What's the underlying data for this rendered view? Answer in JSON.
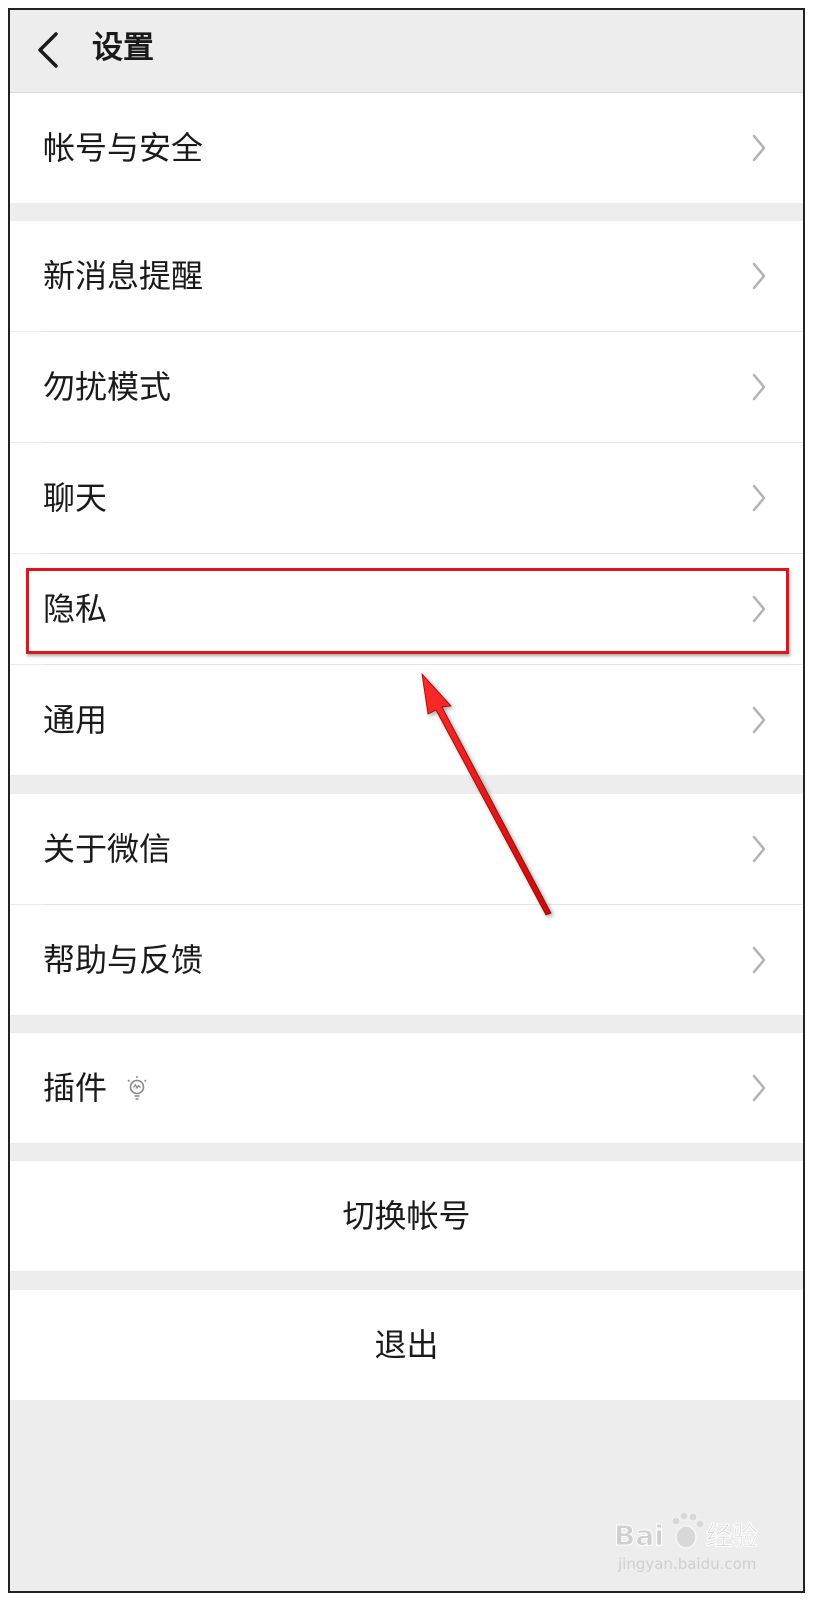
{
  "header": {
    "title": "设置"
  },
  "menu": {
    "account_security": "帐号与安全",
    "new_message": "新消息提醒",
    "do_not_disturb": "勿扰模式",
    "chat": "聊天",
    "privacy": "隐私",
    "general": "通用",
    "about": "关于微信",
    "help_feedback": "帮助与反馈",
    "plugins": "插件"
  },
  "actions": {
    "switch_account": "切换帐号",
    "logout": "退出"
  },
  "watermark": {
    "brand_prefix": "Bai",
    "brand_suffix": "经验",
    "url": "jingyan.baidu.com"
  },
  "colors": {
    "highlight": "#e1141b",
    "background": "#ededed"
  },
  "icons": [
    "back-icon",
    "chevron-right-icon",
    "lightbulb-icon",
    "baidu-paw-icon"
  ]
}
